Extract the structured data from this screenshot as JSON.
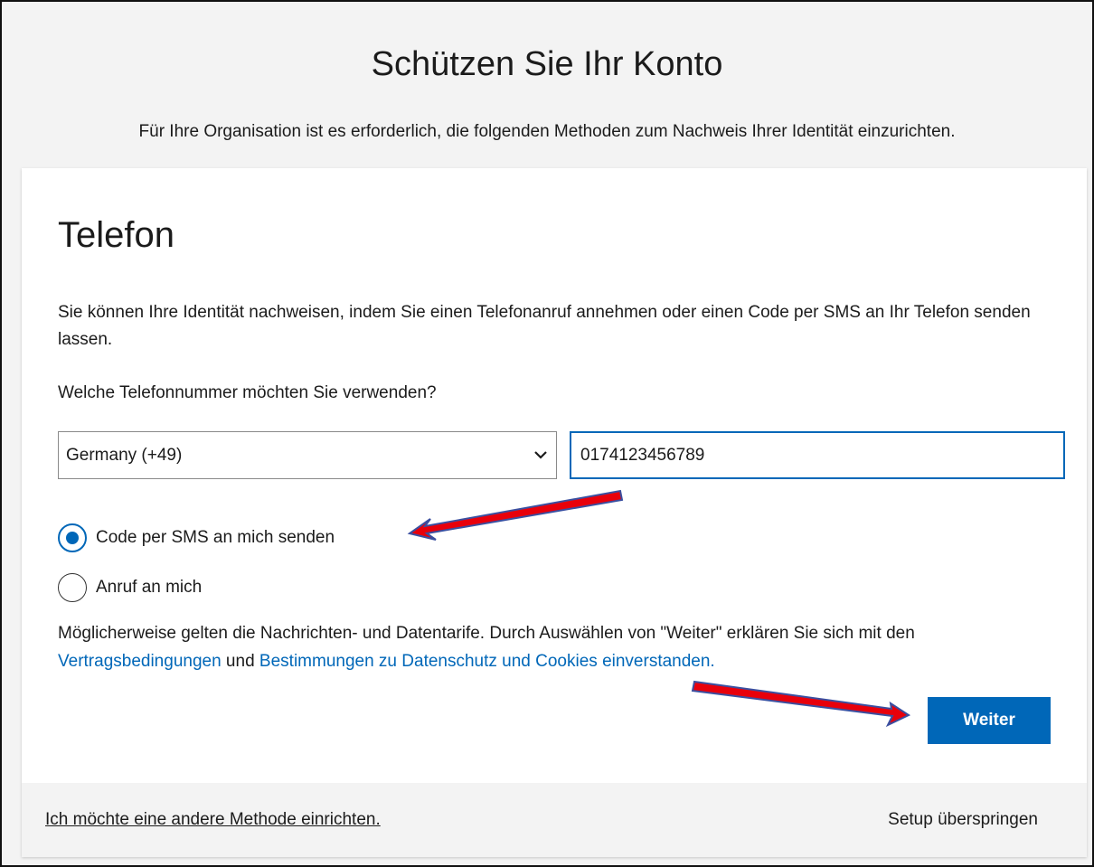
{
  "page": {
    "title": "Schützen Sie Ihr Konto",
    "subtitle": "Für Ihre Organisation ist es erforderlich, die folgenden Methoden zum Nachweis Ihrer Identität einzurichten."
  },
  "card": {
    "section_title": "Telefon",
    "description": "Sie können Ihre Identität nachweisen, indem Sie einen Telefonanruf annehmen oder einen Code per SMS an Ihr Telefon senden lassen.",
    "question": "Welche Telefonnummer möchten Sie verwenden?",
    "country_select": {
      "selected": "Germany (+49)",
      "icon": "chevron-down-icon"
    },
    "phone_input": {
      "value": "0174123456789"
    },
    "options": [
      {
        "label": "Code per SMS an mich senden",
        "checked": true
      },
      {
        "label": "Anruf an mich",
        "checked": false
      }
    ],
    "terms": {
      "text_before": "Möglicherweise gelten die Nachrichten- und Datentarife. Durch Auswählen von \"Weiter\" erklären Sie sich mit den ",
      "link_terms": "Vertragsbedingungen",
      "text_middle": " und ",
      "link_privacy": "Bestimmungen zu Datenschutz und Cookies einverstanden."
    },
    "next_button": "Weiter"
  },
  "footer": {
    "other_method_link": "Ich möchte eine andere Methode einrichten.",
    "skip_setup": "Setup überspringen"
  },
  "annotations": {
    "arrow_color": "#e8000b",
    "arrow_outline": "#3a4fa0"
  },
  "colors": {
    "accent": "#0067b8",
    "background": "#f3f3f3",
    "card": "#ffffff"
  }
}
